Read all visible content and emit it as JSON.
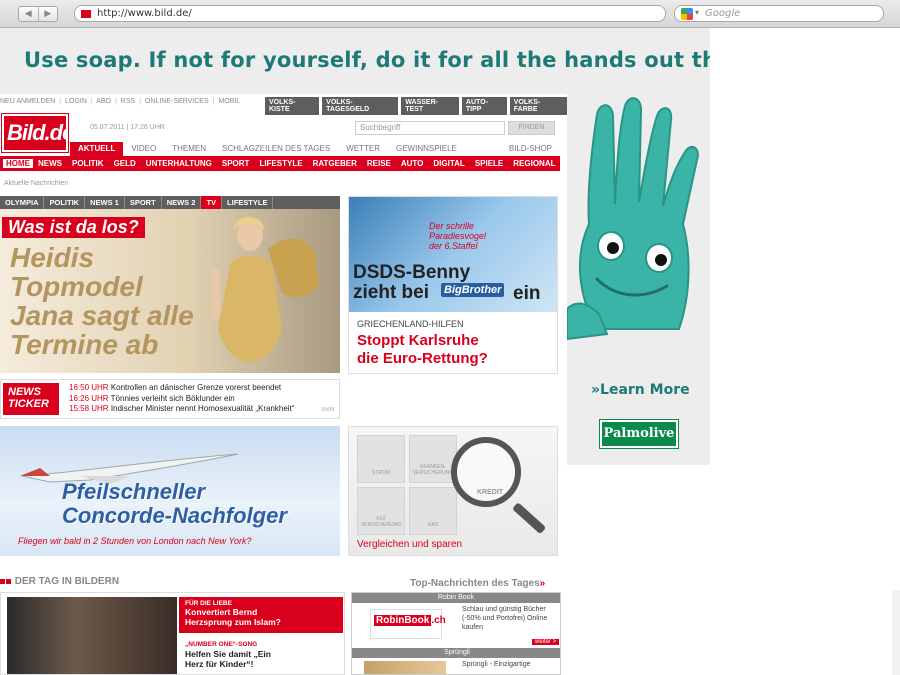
{
  "browser": {
    "back_label": "◀",
    "forward_label": "▶",
    "url": "http://www.bild.de/",
    "search_placeholder": "Google"
  },
  "ad": {
    "headline": "Use soap. If not for yourself, do it for all the hands out there.",
    "learn_more": "»Learn More",
    "brand": "Palmolive",
    "accent_color": "#1d7a76"
  },
  "site": {
    "top_links": [
      "NEU ANMELDEN",
      "LOGIN",
      "ABO",
      "RSS",
      "ONLINE-SERVICES",
      "MOBIL"
    ],
    "service_tabs": [
      "VOLKS-KISTE",
      "VOLKS-TAGESGELD",
      "WASSER-TEST",
      "AUTO-TIPP",
      "VOLKS-FARBE"
    ],
    "logo": "Bild.de",
    "date": "05.07.2011  |  17:26 UHR",
    "search_placeholder": "Suchbegriff",
    "find_label": "FINDEN",
    "nav1": [
      "AKTUELL",
      "VIDEO",
      "THEMEN",
      "SCHLAGZEILEN DES TAGES",
      "WETTER",
      "GEWINNSPIELE"
    ],
    "shop_label": "BILD-SHOP",
    "nav2": [
      "HOME",
      "NEWS",
      "POLITIK",
      "GELD",
      "UNTERHALTUNG",
      "SPORT",
      "LIFESTYLE",
      "RATGEBER",
      "REISE",
      "AUTO",
      "DIGITAL",
      "SPIELE",
      "REGIONAL"
    ],
    "breadcrumb": "Aktuelle Nachrichten",
    "subtabs": [
      "OLYMPIA",
      "POLITIK",
      "NEWS 1",
      "SPORT",
      "NEWS 2",
      "TV",
      "LIFESTYLE"
    ],
    "brand_color": "#d9001d"
  },
  "hero": {
    "question": "Was ist da los?",
    "headline": "Heidis\nTopmodel\nJana sagt alle\nTermine ab"
  },
  "side1": {
    "tag": "Der schrille\nParadiesvogel\nder 6.Staffel",
    "headline": "DSDS-Benny\nzieht bei",
    "badge": "BigBrother",
    "headline_end": "ein",
    "kicker": "GRIECHENLAND-HILFEN",
    "title": "Stoppt Karlsruhe\ndie Euro-Rettung?"
  },
  "ticker": {
    "label": "NEWS\nTICKER",
    "items": [
      {
        "time": "16:50 UHR",
        "text": "Kontrollen an dänischer Grenze vorerst beendet"
      },
      {
        "time": "16:26 UHR",
        "text": "Tönnies verleiht sich Böklunder ein"
      },
      {
        "time": "15:58 UHR",
        "text": "Indischer Minister nennt Homosexualität „Krankheit“"
      }
    ],
    "more": "mehr"
  },
  "concorde": {
    "headline": "Pfeilschneller\nConcorde-Nachfolger",
    "sub": "Fliegen wir bald in 2 Stunden von London nach New York?"
  },
  "compare": {
    "boxes": [
      "STROM",
      "KRANKEN-\nVERSICHERUNG",
      "KFZ\nVERSICHERUNG",
      "GAS"
    ],
    "magnified": "KREDIT",
    "title": "Vergleichen und sparen"
  },
  "bottom": {
    "tag_title": "DER TAG IN BILDERN",
    "top_news": "Top-Nachrichten des Tages",
    "top_news_arrow": "»",
    "kicker1": "FÜR DIE LIEBE",
    "head1": "Konvertiert Bernd\nHerzsprung zum Islam?",
    "kicker2": "„NUMBER ONE“-SONG",
    "head2": "Helfen Sie damit „Ein\nHerz für Kinder“!"
  },
  "partners": {
    "head1": "Robin Book",
    "logo1": "RobinBook",
    "logo1_suffix": ".ch",
    "text1": "Schlau und günstig Bücher (-50% und Portofrei) Online kaufen",
    "weiter": "weiter >",
    "head2": "Sprüngli",
    "text2": "Sprüngli - Einzigartige"
  }
}
